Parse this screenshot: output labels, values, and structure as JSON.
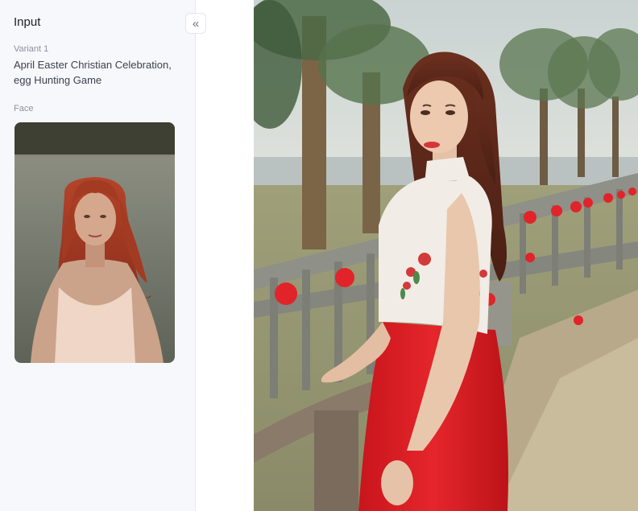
{
  "sidebar": {
    "title": "Input",
    "collapse_icon": "double-chevron-left-icon",
    "variant_label": "Variant 1",
    "prompt": "April Easter Christian Celebration, egg Hunting Game",
    "face_label": "Face"
  },
  "colors": {
    "sidebar_bg": "#f7f8fb",
    "accent_red": "#e0242a"
  }
}
